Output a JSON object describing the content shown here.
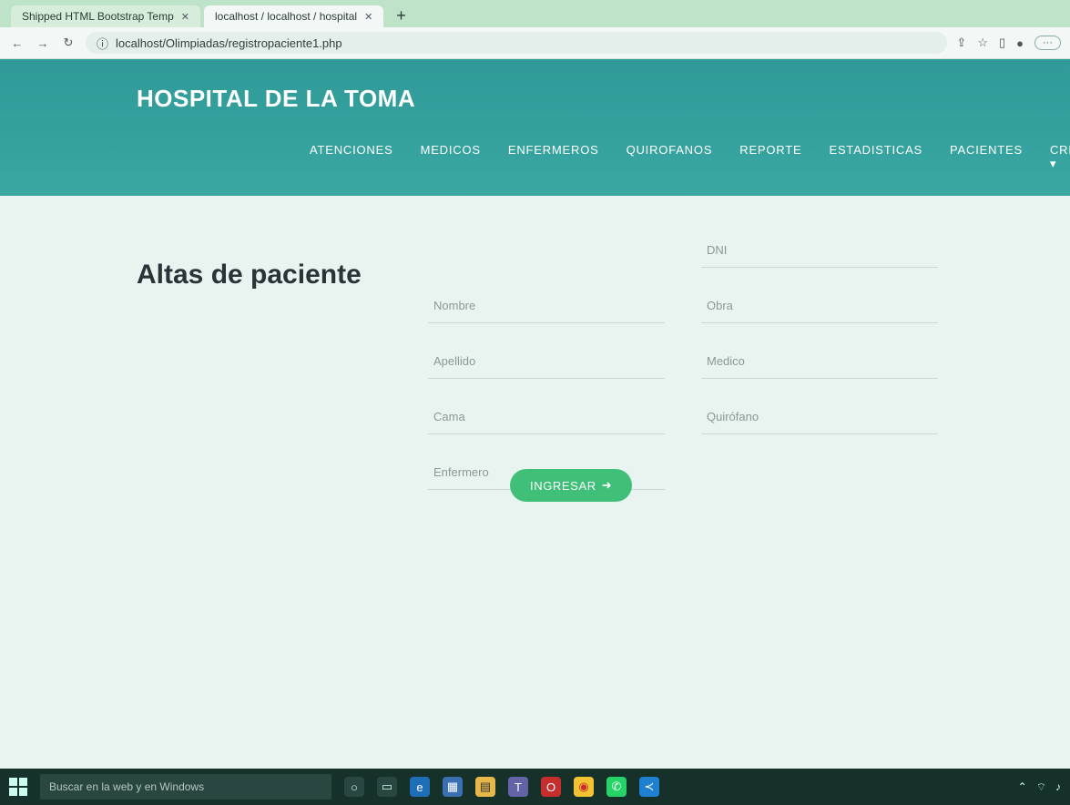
{
  "browser": {
    "tabs": [
      {
        "label": "Shipped HTML Bootstrap Temp",
        "active": false
      },
      {
        "label": "localhost / localhost / hospital",
        "active": true
      }
    ],
    "url": "localhost/Olimpiadas/registropaciente1.php"
  },
  "site": {
    "brand": "HOSPITAL DE LA TOMA",
    "menu": [
      "ATENCIONES",
      "MEDICOS",
      "ENFERMEROS",
      "QUIROFANOS",
      "REPORTE",
      "ESTADISTICAS",
      "PACIENTES",
      "CREAR"
    ]
  },
  "page": {
    "title": "Altas de paciente",
    "fields": [
      {
        "placeholder": ""
      },
      {
        "placeholder": "DNI"
      },
      {
        "placeholder": "Nombre"
      },
      {
        "placeholder": "Obra"
      },
      {
        "placeholder": "Apellido"
      },
      {
        "placeholder": "Medico"
      },
      {
        "placeholder": "Cama"
      },
      {
        "placeholder": "Quirófano"
      },
      {
        "placeholder": "Enfermero"
      }
    ],
    "submit_label": "INGRESAR"
  },
  "taskbar": {
    "search_placeholder": "Buscar en la web y en Windows",
    "apps": [
      "cortana-icon",
      "task-view-icon",
      "edge-icon",
      "store-icon",
      "explorer-icon",
      "teams-icon",
      "opera-icon",
      "chrome-icon",
      "whatsapp-icon",
      "vscode-icon"
    ]
  },
  "colors": {
    "header": "#3aa7a3",
    "button": "#3fbf78",
    "background": "#e9f3ef"
  }
}
